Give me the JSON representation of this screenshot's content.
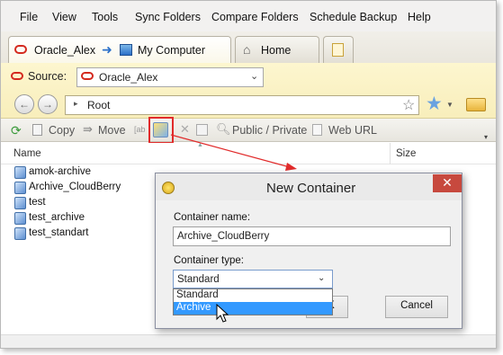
{
  "menu": [
    "File",
    "View",
    "Tools",
    "Sync Folders",
    "Compare Folders",
    "Schedule Backup",
    "Help"
  ],
  "tabs": {
    "active_source": "Oracle_Alex",
    "active_dest": "My Computer",
    "home": "Home"
  },
  "source": {
    "label": "Source:",
    "value": "Oracle_Alex"
  },
  "path": {
    "root": "Root"
  },
  "commands": {
    "copy": "Copy",
    "move": "Move",
    "public_private": "Public / Private",
    "web_url": "Web URL"
  },
  "list": {
    "headers": {
      "name": "Name",
      "size": "Size"
    },
    "items": [
      "amok-archive",
      "Archive_CloudBerry",
      "test",
      "test_archive",
      "test_standart"
    ]
  },
  "dialog": {
    "title": "New Container",
    "close": "✕",
    "name_label": "Container name:",
    "name_value": "Archive_CloudBerry",
    "type_label": "Container type:",
    "type_value": "Standard",
    "options": [
      "Standard",
      "Archive"
    ],
    "ok": "OK",
    "cancel": "Cancel"
  },
  "colors": {
    "accent": "#e12b2b",
    "selection": "#3399ff",
    "toolbar": "#fdf6cf"
  }
}
